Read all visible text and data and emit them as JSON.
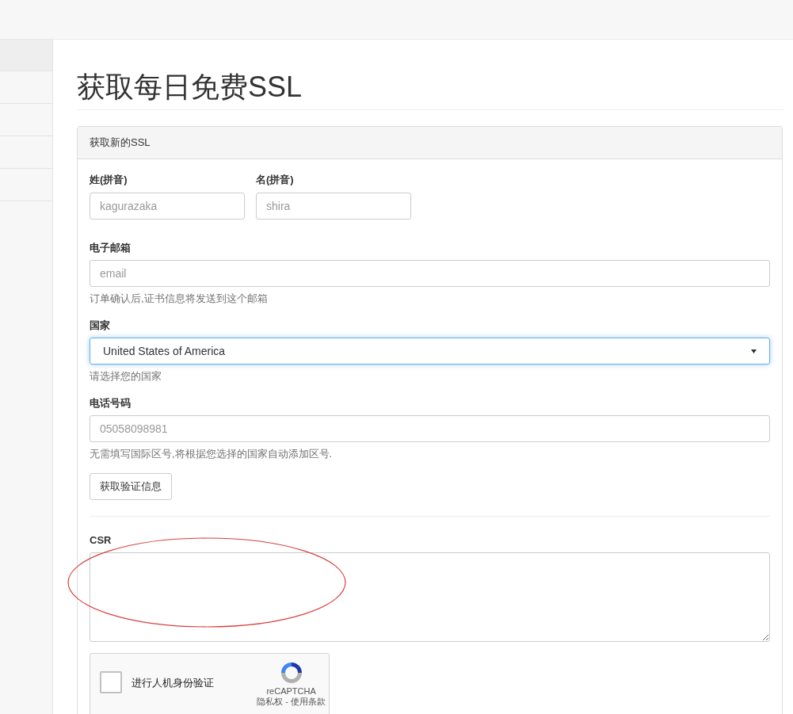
{
  "sidebar": {
    "items": [
      {
        "selected": true
      },
      {
        "selected": false
      },
      {
        "selected": false
      },
      {
        "selected": false
      },
      {
        "selected": false
      }
    ]
  },
  "page_title": "获取每日免费SSL",
  "panel": {
    "title": "获取新的SSL",
    "name_fields": [
      {
        "label": "姓(拼音)",
        "placeholder": "kagurazaka"
      },
      {
        "label": "名(拼音)",
        "placeholder": "shira"
      }
    ],
    "fields": [
      {
        "kind": "input",
        "label": "电子邮箱",
        "placeholder": "email",
        "help": "订单确认后,证书信息将发送到这个邮箱"
      },
      {
        "kind": "select",
        "label": "国家",
        "value": "United States of America",
        "focused": true,
        "help": "请选择您的国家"
      },
      {
        "kind": "input",
        "label": "电话号码",
        "placeholder": "05058098981",
        "help": "无需填写国际区号,将根据您选择的国家自动添加区号."
      }
    ],
    "verify_button": "获取验证信息",
    "csr": {
      "label": "CSR"
    },
    "captcha": {
      "label": "进行人机身份验证",
      "checked": false,
      "brand": "reCAPTCHA",
      "links": "隐私权 - 使用条款"
    }
  },
  "annotations": [
    {
      "kind": "ellipse",
      "color": "#d94040"
    }
  ]
}
